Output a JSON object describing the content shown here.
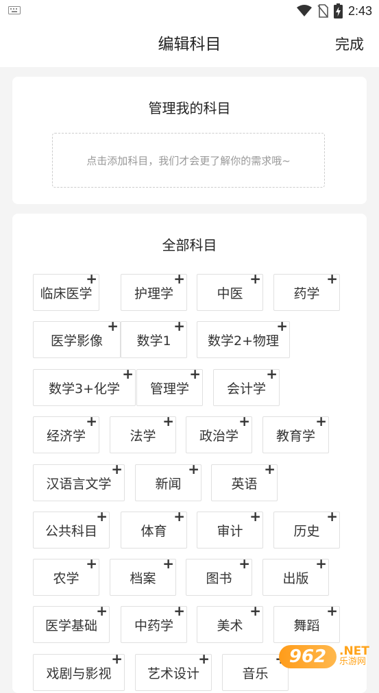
{
  "status_bar": {
    "time": "2:43"
  },
  "nav": {
    "title": "编辑科目",
    "done": "完成"
  },
  "mine": {
    "title": "管理我的科目",
    "hint": "点击添加科目，我们才会更了解你的需求哦~"
  },
  "all": {
    "title": "全部科目",
    "plus": "+",
    "tags": [
      "临床医学",
      "护理学",
      "中医",
      "药学",
      "医学影像",
      "数学1",
      "数学2+物理",
      "数学3+化学",
      "管理学",
      "会计学",
      "经济学",
      "法学",
      "政治学",
      "教育学",
      "汉语言文学",
      "新闻",
      "英语",
      "公共科目",
      "体育",
      "审计",
      "历史",
      "农学",
      "档案",
      "图书",
      "出版",
      "医学基础",
      "中药学",
      "美术",
      "舞蹈",
      "戏剧与影视",
      "艺术设计",
      "音乐"
    ]
  },
  "watermark": {
    "logo": "962",
    "net": ".NET",
    "cn": "乐游网"
  }
}
